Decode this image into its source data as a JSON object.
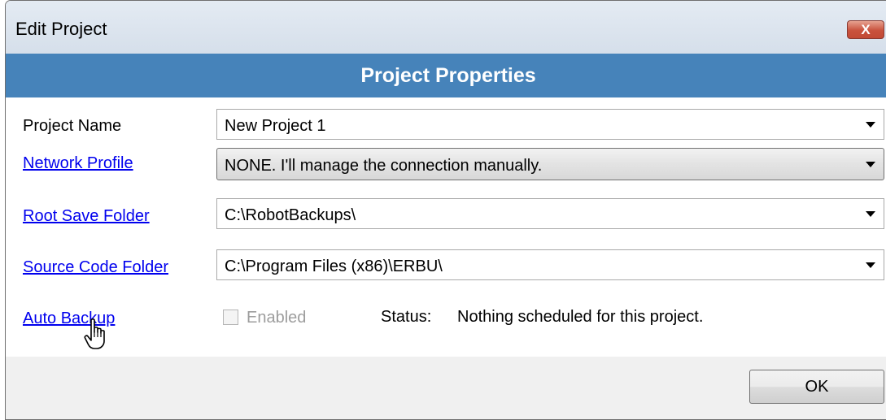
{
  "window": {
    "title": "Edit Project",
    "close_label": "X"
  },
  "header": {
    "title": "Project Properties"
  },
  "fields": {
    "project_name": {
      "label": "Project Name",
      "value": "New Project 1"
    },
    "network_profile": {
      "label": "Network Profile",
      "value": "NONE. I'll manage the connection manually."
    },
    "root_save_folder": {
      "label": "Root Save Folder",
      "value": "C:\\RobotBackups\\"
    },
    "source_code_folder": {
      "label": "Source Code Folder",
      "value": "C:\\Program Files (x86)\\ERBU\\"
    },
    "auto_backup": {
      "label": "Auto Backup",
      "checkbox_label": "Enabled",
      "checked": false,
      "status_prefix": "Status:",
      "status_value": "Nothing scheduled for this project."
    }
  },
  "footer": {
    "ok_label": "OK"
  },
  "icons": {
    "dropdown": "chevron-down-icon",
    "cursor": "hand-pointer-icon",
    "close": "close-icon"
  },
  "colors": {
    "header_band": "#4683ba",
    "link": "#0000ee",
    "close_button": "#c9523d"
  }
}
